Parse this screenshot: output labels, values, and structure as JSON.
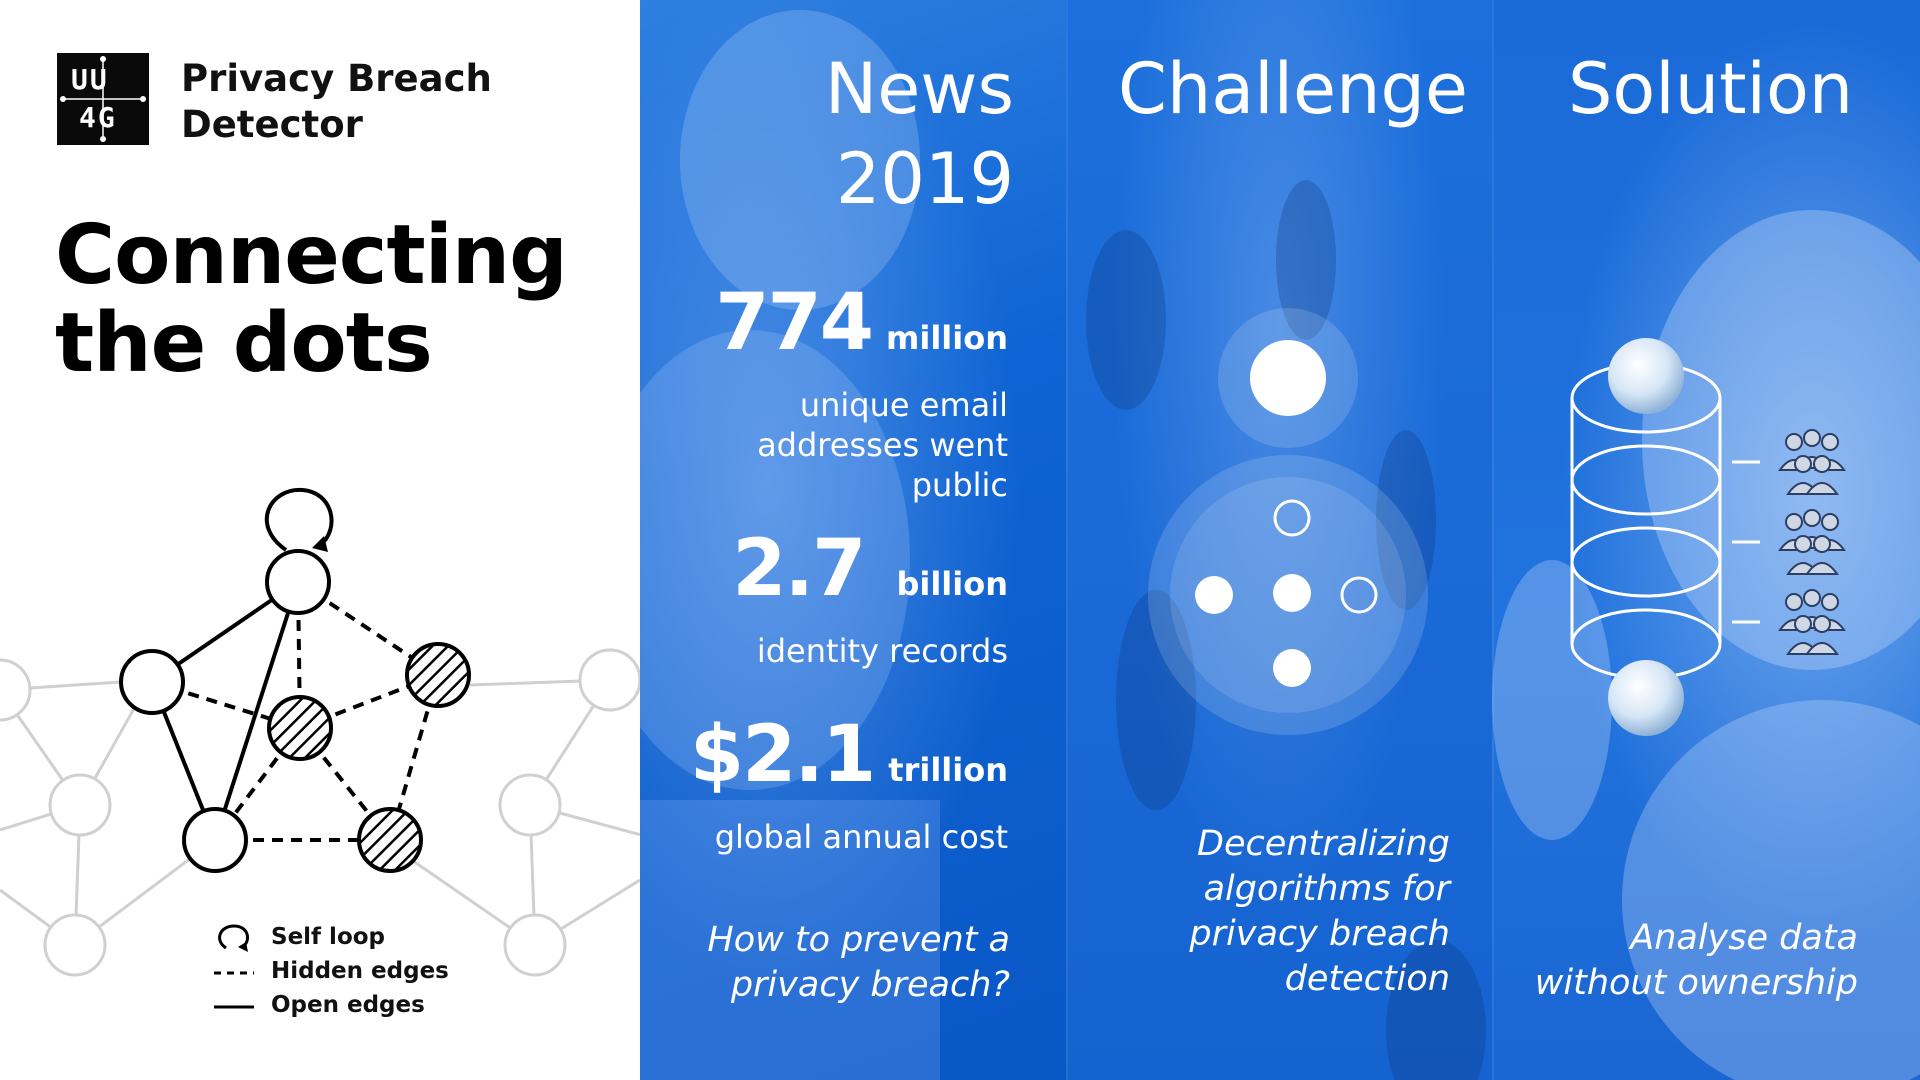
{
  "brand": {
    "logo_text_top": "UU",
    "logo_text_bottom": "4G",
    "title_line1": "Privacy Breach",
    "title_line2": "Detector"
  },
  "headline": {
    "line1": "Connecting",
    "line2": "the dots"
  },
  "legend": {
    "self_loop": "Self loop",
    "hidden_edges": "Hidden edges",
    "open_edges": "Open edges"
  },
  "news": {
    "title_line1": "News",
    "title_line2": "2019",
    "stats": [
      {
        "value": "774",
        "unit": "million",
        "desc": [
          "unique email",
          "addresses went",
          "public"
        ]
      },
      {
        "value": "2.7",
        "unit": "billion",
        "desc": [
          "identity records"
        ]
      },
      {
        "value": "$2.1",
        "unit": "trillion",
        "desc": [
          "global annual cost"
        ]
      }
    ],
    "question_line1": "How to prevent a",
    "question_line2": "privacy breach?"
  },
  "challenge": {
    "title": "Challenge",
    "caption": [
      "Decentralizing",
      "algorithms for",
      "privacy breach",
      "detection"
    ]
  },
  "solution": {
    "title": "Solution",
    "caption_line1": "Analyse data",
    "caption_line2": "without ownership"
  },
  "colors": {
    "panel_blue": "#0e64d4",
    "accent_white": "#ffffff",
    "text_dark": "#111111"
  }
}
